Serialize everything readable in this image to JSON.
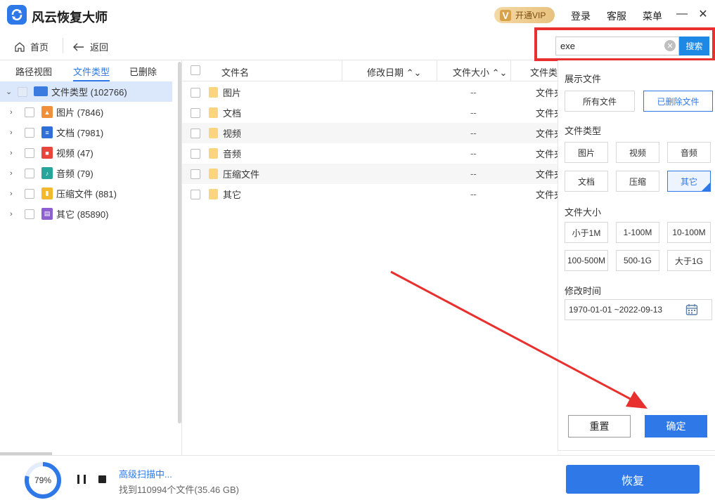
{
  "app": {
    "title": "风云恢复大师",
    "vip_label": "开通VIP",
    "login_label": "登录",
    "service_label": "客服",
    "menu_label": "菜单",
    "minimize_glyph": "—",
    "close_glyph": "✕"
  },
  "nav": {
    "home_label": "首页",
    "back_label": "返回"
  },
  "search": {
    "value": "exe",
    "button_label": "搜索"
  },
  "left_tabs": [
    "路径视图",
    "文件类型",
    "已删除"
  ],
  "tree": {
    "root": {
      "label": "文件类型 (102766)"
    },
    "items": [
      {
        "label": "图片 (7846)",
        "icon": "image-icon",
        "color": "#f0903a"
      },
      {
        "label": "文档 (7981)",
        "icon": "document-icon",
        "color": "#2f6fd8"
      },
      {
        "label": "视频 (47)",
        "icon": "video-icon",
        "color": "#e8453c"
      },
      {
        "label": "音频 (79)",
        "icon": "audio-icon",
        "color": "#26a69a"
      },
      {
        "label": "压缩文件 (881)",
        "icon": "archive-icon",
        "color": "#f4b82e"
      },
      {
        "label": "其它 (85890)",
        "icon": "other-icon",
        "color": "#8e5fd0"
      }
    ]
  },
  "list": {
    "columns": [
      "文件名",
      "修改日期",
      "文件大小",
      "文件类"
    ],
    "rows": [
      {
        "name": "图片",
        "size": "--",
        "type": "文件夹"
      },
      {
        "name": "文档",
        "size": "--",
        "type": "文件夹"
      },
      {
        "name": "视频",
        "size": "--",
        "type": "文件夹"
      },
      {
        "name": "音频",
        "size": "--",
        "type": "文件夹"
      },
      {
        "name": "压缩文件",
        "size": "--",
        "type": "文件夹"
      },
      {
        "name": "其它",
        "size": "--",
        "type": "文件夹"
      }
    ]
  },
  "filter": {
    "show_title": "展示文件",
    "show_options": [
      "所有文件",
      "已删除文件"
    ],
    "type_title": "文件类型",
    "type_options": [
      "图片",
      "视频",
      "音频",
      "文档",
      "压缩",
      "其它"
    ],
    "size_title": "文件大小",
    "size_options": [
      "小于1M",
      "1-100M",
      "10-100M",
      "100-500M",
      "500-1G",
      "大于1G"
    ],
    "time_title": "修改时间",
    "date_range": "1970-01-01 ~2022-09-13",
    "reset_label": "重置",
    "ok_label": "确定"
  },
  "bottom": {
    "progress_percent": 79,
    "progress_text": "79%",
    "status": "高级扫描中...",
    "found": "找到110994个文件(35.46 GB)",
    "recover_label": "恢复"
  },
  "colors": {
    "accent": "#2f78e8",
    "highlight_red": "#e8302f"
  }
}
